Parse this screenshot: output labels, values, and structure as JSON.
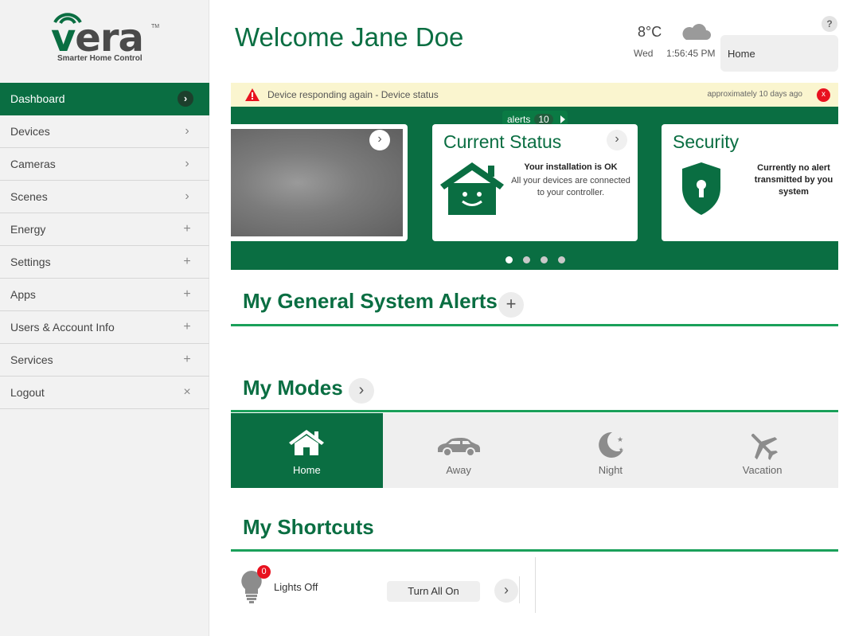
{
  "brand": {
    "name": "vera",
    "tagline": "Smarter Home Control",
    "tm": "TM"
  },
  "sidebar": {
    "items": [
      {
        "label": "Dashboard",
        "icon": "chevron-right-icon",
        "glyph": "›",
        "active": true
      },
      {
        "label": "Devices",
        "icon": "chevron-right-icon",
        "glyph": "›"
      },
      {
        "label": "Cameras",
        "icon": "chevron-right-icon",
        "glyph": "›"
      },
      {
        "label": "Scenes",
        "icon": "chevron-right-icon",
        "glyph": "›"
      },
      {
        "label": "Energy",
        "icon": "plus-icon",
        "glyph": "+"
      },
      {
        "label": "Settings",
        "icon": "plus-icon",
        "glyph": "+"
      },
      {
        "label": "Apps",
        "icon": "plus-icon",
        "glyph": "+"
      },
      {
        "label": "Users & Account Info",
        "icon": "plus-icon",
        "glyph": "+"
      },
      {
        "label": "Services",
        "icon": "plus-icon",
        "glyph": "+"
      },
      {
        "label": "Logout",
        "icon": "close-icon",
        "glyph": "×"
      }
    ]
  },
  "header": {
    "welcome": "Welcome Jane Doe",
    "temperature": "8°C",
    "weather_icon": "cloud-icon",
    "day": "Wed",
    "time": "1:56:45 PM",
    "location": "Home",
    "help": "?"
  },
  "alert_bar": {
    "message": "Device responding again - Device status",
    "age": "approximately 10 days ago",
    "close": "x"
  },
  "carousel": {
    "alerts_label": "alerts",
    "alerts_count": "10",
    "status_card": {
      "title": "Current Status",
      "bold": "Your installation is OK",
      "text": "All your devices are connected to your controller."
    },
    "security_card": {
      "title": "Security",
      "text_line1": "Currently no alert",
      "text_line2": "transmitted by you",
      "text_line3": "system"
    },
    "page_count": 4,
    "active_page": 1
  },
  "sections": {
    "alerts_title": "My General System Alerts",
    "modes_title": "My Modes",
    "shortcuts_title": "My Shortcuts"
  },
  "modes": [
    {
      "label": "Home",
      "icon": "house-icon",
      "active": true
    },
    {
      "label": "Away",
      "icon": "car-icon"
    },
    {
      "label": "Night",
      "icon": "moon-icon"
    },
    {
      "label": "Vacation",
      "icon": "plane-icon"
    }
  ],
  "shortcut": {
    "label": "Lights Off",
    "count": "0",
    "button": "Turn All On"
  },
  "colors": {
    "brand_green": "#0a6e42",
    "accent_green": "#1aa05a",
    "alert_red": "#e8121f",
    "alert_bg": "#faf5cf"
  }
}
